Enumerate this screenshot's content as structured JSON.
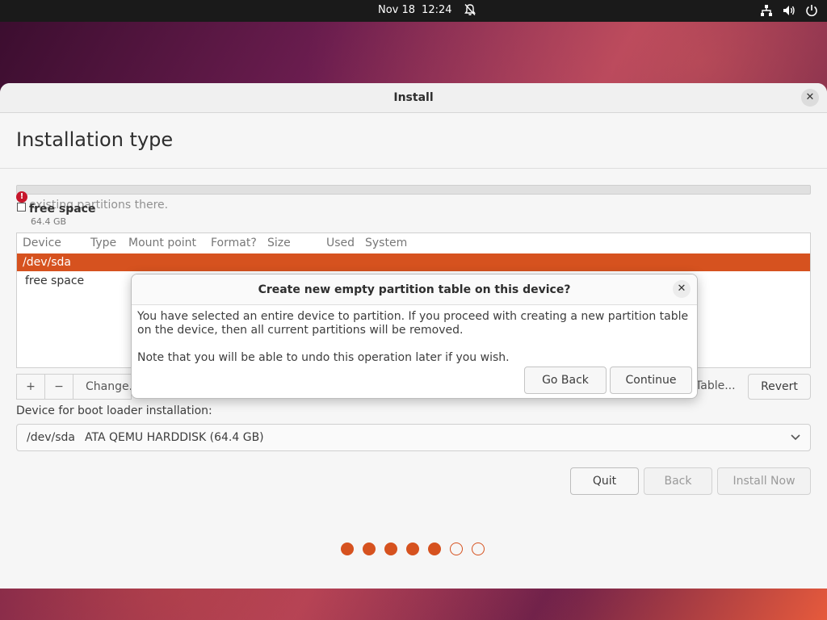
{
  "topbar": {
    "date": "Nov 18",
    "time": "12:24",
    "icons": [
      "bell-off-icon",
      "network-icon",
      "volume-icon",
      "power-icon"
    ]
  },
  "window": {
    "title": "Install",
    "page_title": "Installation type",
    "warning_text": "existing partitions there.",
    "legend": {
      "label": "free space",
      "size": "64.4 GB"
    },
    "table": {
      "headers": [
        "Device",
        "Type",
        "Mount point",
        "Format?",
        "Size",
        "Used",
        "System"
      ],
      "rows": [
        "/dev/sda",
        "free space"
      ]
    },
    "toolbar": {
      "add": "+",
      "remove": "−",
      "change": "Change...",
      "new_table": "Table...",
      "revert": "Revert"
    },
    "boot_label": "Device for boot loader installation:",
    "boot_device": "/dev/sda",
    "boot_desc": "ATA QEMU HARDDISK (64.4 GB)",
    "buttons": {
      "quit": "Quit",
      "back": "Back",
      "install_now": "Install Now"
    },
    "progress": {
      "total_steps": 7,
      "completed_steps": 5
    }
  },
  "dialog": {
    "title": "Create new empty partition table on this device?",
    "message": "You have selected an entire device to partition. If you proceed with creating a new partition table on the device, then all current partitions will be removed.",
    "note": "Note that you will be able to undo this operation later if you wish.",
    "go_back": "Go Back",
    "continue": "Continue"
  },
  "colors": {
    "accent": "#d6521f",
    "topbar": "#1a1a1a"
  }
}
